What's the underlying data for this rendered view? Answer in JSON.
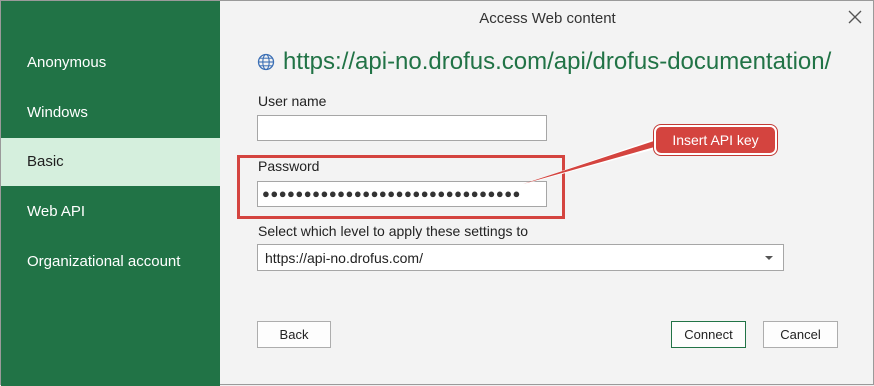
{
  "window": {
    "title": "Access Web content",
    "close_glyph": "✕"
  },
  "sidebar": {
    "selected": "Basic",
    "items": [
      {
        "label": "Anonymous"
      },
      {
        "label": "Windows"
      },
      {
        "label": "Basic"
      },
      {
        "label": "Web API"
      },
      {
        "label": "Organizational account"
      }
    ]
  },
  "main": {
    "url": "https://api-no.drofus.com/api/drofus-documentation/",
    "username": {
      "label": "User name",
      "value": ""
    },
    "password": {
      "label": "Password",
      "value": "●●●●●●●●●●●●●●●●●●●●●●●●●●●●●●●"
    },
    "level": {
      "label": "Select which level to apply these settings to",
      "value": "https://api-no.drofus.com/"
    }
  },
  "annotation": {
    "callout_text": "Insert API key",
    "color": "#d4443f"
  },
  "footer": {
    "back_label": "Back",
    "connect_label": "Connect",
    "cancel_label": "Cancel"
  },
  "colors": {
    "sidebar_bg": "#217346",
    "sidebar_selected_bg": "#d5efdd",
    "url_text": "#217346",
    "highlight": "#d4443f"
  },
  "icons": {
    "globe": "globe-icon",
    "close": "close-icon",
    "dropdown": "chevron-down-icon"
  }
}
